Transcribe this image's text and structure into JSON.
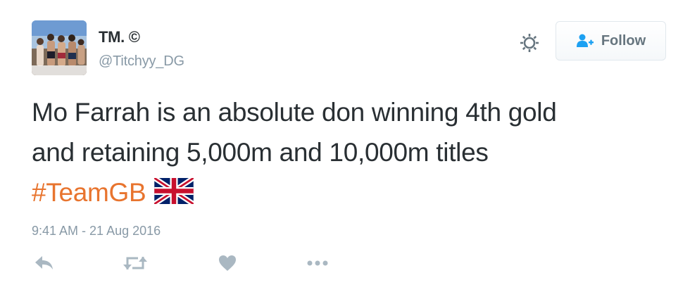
{
  "user": {
    "display_name": "TM. ©",
    "username": "@Titchyy_DG"
  },
  "header": {
    "settings_icon": "gear-icon",
    "follow_label": "Follow",
    "follow_icon": "add-user-icon"
  },
  "tweet": {
    "line1": "Mo Farrah is an absolute don winning 4th gold",
    "line2": "and retaining 5,000m and 10,000m titles",
    "hashtag": "#TeamGB",
    "emoji": "union-jack-flag",
    "timestamp": "9:41 AM - 21 Aug 2016"
  },
  "actions": [
    "reply-icon",
    "retweet-icon",
    "like-icon",
    "more-icon"
  ],
  "colors": {
    "text": "#292f33",
    "muted": "#8899a6",
    "hashtag": "#e8742e",
    "icon": "#aab8c2",
    "follow_icon": "#1da1f2"
  }
}
